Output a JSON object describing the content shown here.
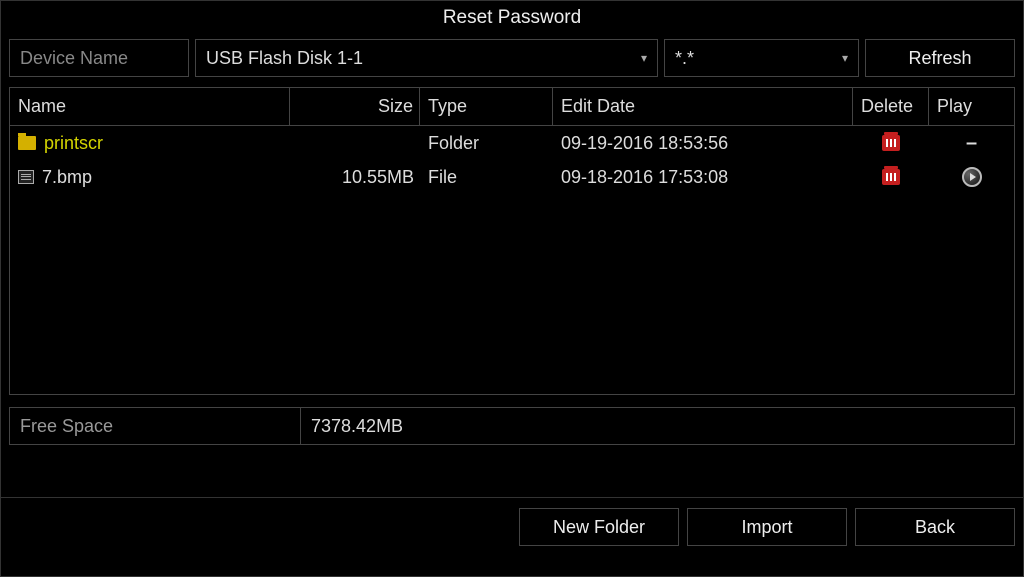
{
  "title": "Reset Password",
  "top": {
    "device_label": "Device Name",
    "device_value": "USB Flash Disk 1-1",
    "filter_value": "*.*",
    "refresh": "Refresh"
  },
  "headers": {
    "name": "Name",
    "size": "Size",
    "type": "Type",
    "date": "Edit Date",
    "delete": "Delete",
    "play": "Play"
  },
  "rows": [
    {
      "name": "printscr",
      "size": "",
      "type": "Folder",
      "date": "09-19-2016 18:53:56",
      "kind": "folder"
    },
    {
      "name": "7.bmp",
      "size": "10.55MB",
      "type": "File",
      "date": "09-18-2016 17:53:08",
      "kind": "file"
    }
  ],
  "free_space": {
    "label": "Free Space",
    "value": "7378.42MB"
  },
  "buttons": {
    "new_folder": "New Folder",
    "import": "Import",
    "back": "Back"
  }
}
